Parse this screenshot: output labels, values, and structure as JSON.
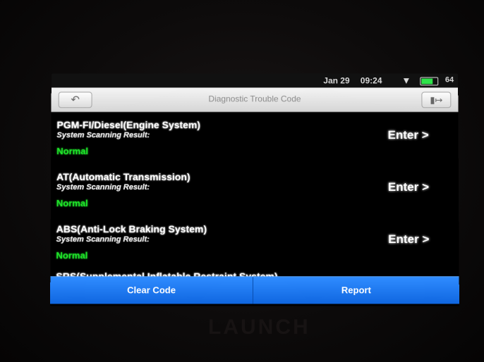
{
  "status_bar": {
    "date": "Jan 29",
    "time": "09:24",
    "battery": "64"
  },
  "header": {
    "title": "Diagnostic Trouble Code",
    "back_icon": "back-arrow-icon",
    "exit_icon": "exit-icon"
  },
  "systems": [
    {
      "name": "PGM-FI/Diesel(Engine System)",
      "sub_label": "System Scanning Result:",
      "result": "Normal",
      "action": "Enter >"
    },
    {
      "name": "AT(Automatic Transmission)",
      "sub_label": "System Scanning Result:",
      "result": "Normal",
      "action": "Enter >"
    },
    {
      "name": "ABS(Anti-Lock Braking System)",
      "sub_label": "System Scanning Result:",
      "result": "Normal",
      "action": "Enter >"
    }
  ],
  "partially_visible_item": "SRS(Supplemental Inflatable Restraint System)",
  "buttons": {
    "clear": "Clear Code",
    "report": "Report"
  },
  "device_brand": "LAUNCH",
  "colors": {
    "result_ok": "#1fe42a",
    "button_bar": "#1a73f0"
  }
}
